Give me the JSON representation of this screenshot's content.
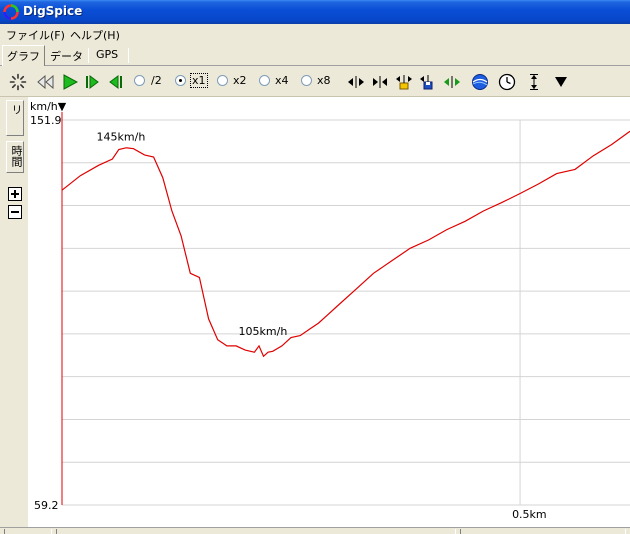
{
  "window": {
    "title": "DigSpice"
  },
  "menu": {
    "file": "ファイル(F)",
    "help": "ヘルプ(H)"
  },
  "tabs": [
    {
      "label": "グラフ",
      "active": true
    },
    {
      "label": "データ",
      "active": false
    },
    {
      "label": "GPS",
      "active": false
    }
  ],
  "toolbar": {
    "speed_options": [
      "/2",
      "x1",
      "x2",
      "x4",
      "x8"
    ],
    "selected_speed": "x1"
  },
  "side": {
    "tab_course": "キョリ",
    "tab_time": "時間"
  },
  "chart_data": {
    "type": "line",
    "ylabel": "km/h",
    "xlabel": "",
    "ylim": [
      59.2,
      151.9
    ],
    "y_tick_labels": [
      "151.9",
      "59.2"
    ],
    "x_tick_labels": [
      {
        "value": 0.5,
        "label": "0.5km"
      }
    ],
    "xlim": [
      0,
      0.62
    ],
    "series_color": "#e00000",
    "grid": true,
    "annotations": [
      {
        "text": "145km/h",
        "x": 0.065,
        "y": 145
      },
      {
        "text": "105km/h",
        "x": 0.22,
        "y": 105
      }
    ],
    "x": [
      0.0,
      0.02,
      0.04,
      0.055,
      0.062,
      0.07,
      0.078,
      0.09,
      0.1,
      0.11,
      0.12,
      0.13,
      0.14,
      0.15,
      0.16,
      0.17,
      0.18,
      0.19,
      0.2,
      0.21,
      0.215,
      0.22,
      0.225,
      0.23,
      0.24,
      0.25,
      0.26,
      0.27,
      0.28,
      0.29,
      0.3,
      0.32,
      0.34,
      0.36,
      0.38,
      0.4,
      0.42,
      0.44,
      0.46,
      0.48,
      0.5,
      0.52,
      0.54,
      0.56,
      0.58,
      0.6,
      0.62
    ],
    "values": [
      135,
      138.5,
      141,
      142.5,
      144.8,
      145.2,
      145,
      143.5,
      143,
      138,
      130,
      124,
      115,
      114,
      104,
      99,
      97.5,
      97.5,
      96.5,
      96,
      97.5,
      95,
      96,
      96.2,
      97.5,
      99.5,
      100,
      101.5,
      103,
      105,
      107,
      111,
      115,
      118,
      121,
      123,
      125.5,
      127.5,
      130,
      132,
      134.2,
      136.5,
      139,
      140,
      143.3,
      146,
      149.2
    ]
  },
  "colors": {
    "grid": "#d4d4d4",
    "axis": "#e00000",
    "line": "#e00000",
    "title_bar": "#0a4fd6"
  }
}
